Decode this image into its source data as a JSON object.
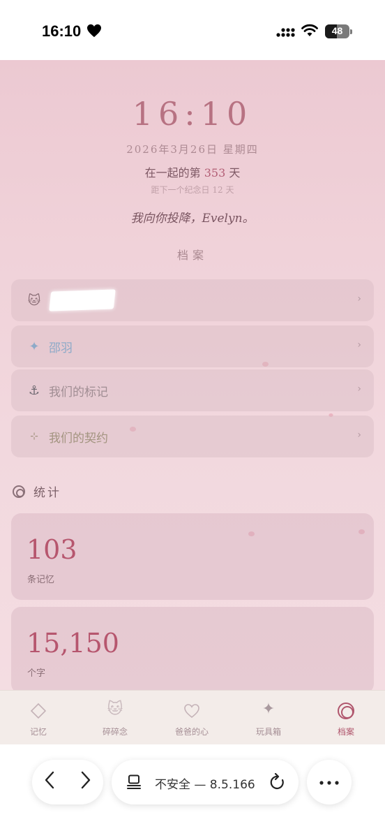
{
  "status_bar": {
    "time": "16:10",
    "battery": "48"
  },
  "header": {
    "time": "16:10",
    "date": "2026年3月26日  星期四",
    "together_prefix": "在一起的第",
    "together_days": "353",
    "together_suffix": "天",
    "next_anniversary": "距下一个纪念日 12 天",
    "message": "我向你投降，Evelyn。",
    "section_title": "档案"
  },
  "profile_cards": [
    {
      "icon": "🐱",
      "label": "",
      "redacted": true,
      "color": "#7d5864"
    },
    {
      "icon": "✦",
      "label": "邵羽",
      "color": "#8eaac8"
    },
    {
      "icon": "⚓",
      "label": "我们的标记",
      "color": "#a08d93"
    },
    {
      "icon": "⊹",
      "label": "我们的契约",
      "color": "#a39480"
    }
  ],
  "stats": {
    "title": "统计",
    "items": [
      {
        "value": "103",
        "unit": "条记忆"
      },
      {
        "value": "15,150",
        "unit": "个字"
      }
    ]
  },
  "tabs": [
    {
      "icon": "diamond-icon",
      "label": "记忆"
    },
    {
      "icon": "cat-icon",
      "label": "碎碎念"
    },
    {
      "icon": "heart-icon",
      "label": "爸爸的心"
    },
    {
      "icon": "sparkle-icon",
      "label": "玩具箱"
    },
    {
      "icon": "target-icon",
      "label": "档案",
      "active": true
    }
  ],
  "browser": {
    "url_text": "不安全 — 8.5.166"
  },
  "colors": {
    "accent": "#b0566d",
    "background": "#f0d2d9"
  }
}
